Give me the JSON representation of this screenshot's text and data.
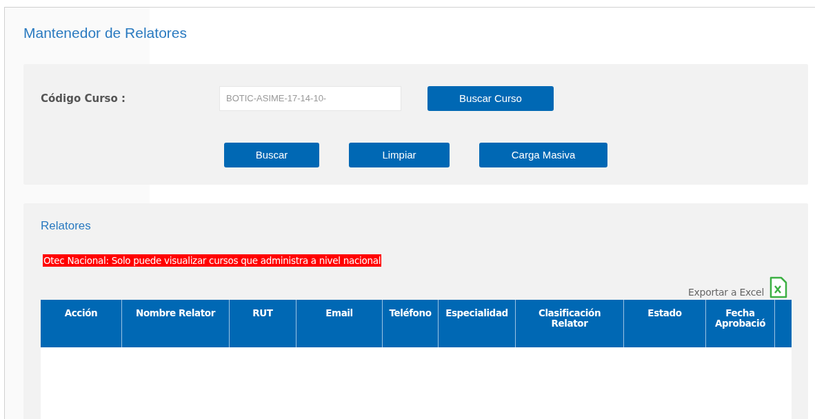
{
  "page": {
    "title": "Mantenedor de Relatores"
  },
  "search": {
    "label": "Código Curso :",
    "value": "BOTIC-ASIME-17-14-10-",
    "search_course_button": "Buscar Curso",
    "buttons": [
      "Buscar",
      "Limpiar",
      "Carga Masiva"
    ]
  },
  "results": {
    "title": "Relatores",
    "alert": "Otec Nacional: Solo puede visualizar cursos que administra a nivel nacional",
    "export_link": "Exportar a Excel",
    "table": {
      "columns": [
        {
          "label": "Acción"
        },
        {
          "label": "Nombre Relator"
        },
        {
          "label": "RUT"
        },
        {
          "label": "Email"
        },
        {
          "label": "Teléfono"
        },
        {
          "label": "Especialidad"
        },
        {
          "label": "Clasificación Relator"
        },
        {
          "label": "Estado"
        },
        {
          "label": "Fecha Aprobació"
        }
      ]
    }
  }
}
